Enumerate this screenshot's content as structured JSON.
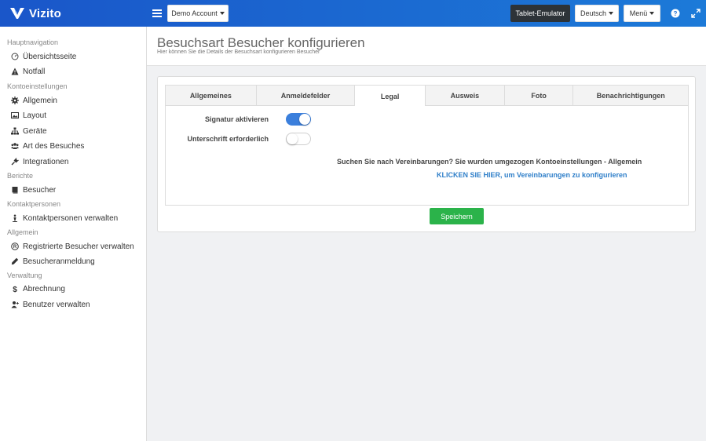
{
  "brand": {
    "name": "Vizito"
  },
  "topbar": {
    "account_label": "Demo Account",
    "tablet_label": "Tablet-Emulator",
    "language_label": "Deutsch",
    "menu_label": "Menü"
  },
  "sidebar": {
    "sections": [
      {
        "title": "Hauptnavigation",
        "items": [
          {
            "label": "Übersichtsseite",
            "icon": "dashboard-icon"
          },
          {
            "label": "Notfall",
            "icon": "warning-icon"
          }
        ]
      },
      {
        "title": "Kontoeinstellungen",
        "items": [
          {
            "label": "Allgemein",
            "icon": "gear-icon"
          },
          {
            "label": "Layout",
            "icon": "image-icon"
          },
          {
            "label": "Geräte",
            "icon": "sitemap-icon"
          },
          {
            "label": "Art des Besuches",
            "icon": "users-icon"
          },
          {
            "label": "Integrationen",
            "icon": "plug-icon"
          }
        ]
      },
      {
        "title": "Berichte",
        "items": [
          {
            "label": "Besucher",
            "icon": "book-icon"
          }
        ]
      },
      {
        "title": "Kontaktpersonen",
        "items": [
          {
            "label": "Kontaktpersonen verwalten",
            "icon": "person-icon"
          }
        ]
      },
      {
        "title": "Allgemein",
        "items": [
          {
            "label": "Registrierte Besucher verwalten",
            "icon": "registered-icon"
          },
          {
            "label": "Besucheranmeldung",
            "icon": "pencil-icon"
          }
        ]
      },
      {
        "title": "Verwaltung",
        "items": [
          {
            "label": "Abrechnung",
            "icon": "dollar-icon"
          },
          {
            "label": "Benutzer verwalten",
            "icon": "user-plus-icon"
          }
        ]
      }
    ]
  },
  "header": {
    "title": "Besuchsart Besucher konfigurieren",
    "subtitle": "Hier können Sie die Details der Besuchsart konfigurieren Besucher"
  },
  "tabs": [
    {
      "label": "Allgemeines",
      "active": false
    },
    {
      "label": "Anmeldefelder",
      "active": false
    },
    {
      "label": "Legal",
      "active": true
    },
    {
      "label": "Ausweis",
      "active": false
    },
    {
      "label": "Foto",
      "active": false
    },
    {
      "label": "Benachrichtigungen",
      "active": false
    }
  ],
  "legal": {
    "signature_label": "Signatur aktivieren",
    "signature_enabled": true,
    "handwriting_label": "Unterschrift erforderlich",
    "handwriting_enabled": false,
    "info_text": "Suchen Sie nach Vereinbarungen? Sie wurden umgezogen Kontoeinstellungen - Allgemein",
    "info_link": "KLICKEN SIE HIER, um Vereinbarungen zu konfigurieren"
  },
  "actions": {
    "save_label": "Speichern"
  },
  "colors": {
    "topbar_start": "#1a56c9",
    "topbar_end": "#1c7ad8",
    "toggle_on": "#3b7fdc",
    "save_button": "#2bb34a",
    "link": "#2f7fc9"
  }
}
